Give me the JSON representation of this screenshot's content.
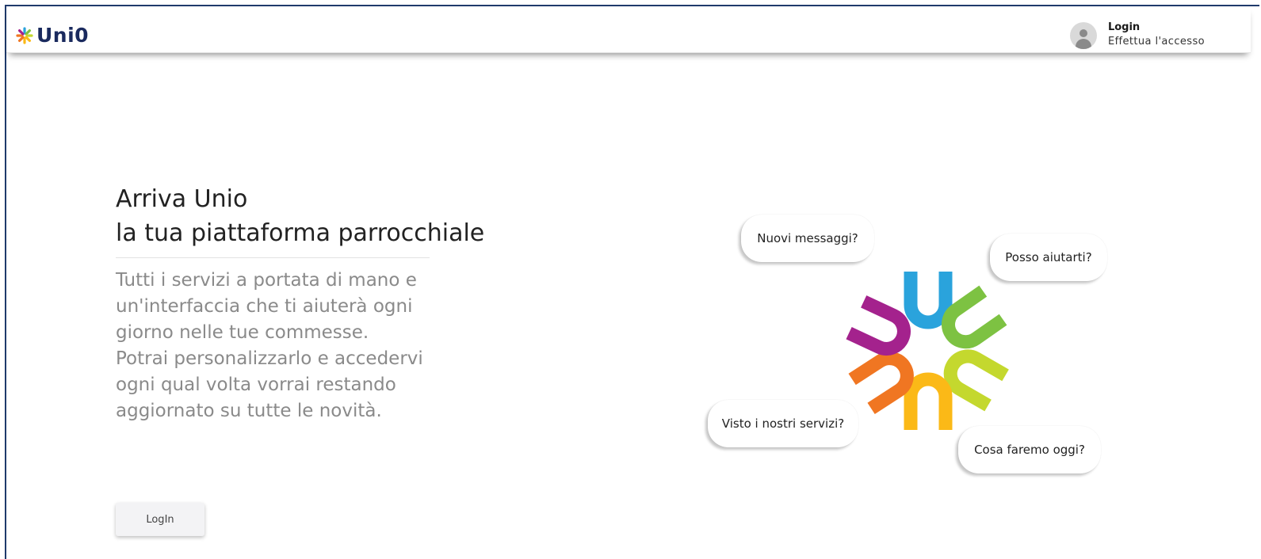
{
  "header": {
    "logo_text": "Uni0",
    "user": {
      "title": "Login",
      "subtitle": "Effettua l'accesso"
    }
  },
  "hero": {
    "title_line1": "Arriva Unio",
    "title_line2": "la tua piattaforma parrocchiale",
    "description_p1": "Tutti i servizi a portata di mano e un'interfaccia che ti aiuterà ogni giorno nelle tue commesse.",
    "description_p2": "Potrai personalizzarlo e accedervi ogni qual volta vorrai restando aggiornato su tutte le novità.",
    "button_label": "LogIn"
  },
  "bubbles": {
    "messages": "Nuovi messaggi?",
    "help": "Posso aiutarti?",
    "services": "Visto i nostri servizi?",
    "today": "Cosa faremo oggi?"
  },
  "colors": {
    "brand_navy": "#1a2a5e",
    "blue": "#2aa3dc",
    "green": "#7dc242",
    "lime": "#c4d82e",
    "yellow": "#fbb917",
    "orange": "#f07622",
    "purple": "#a4228d"
  }
}
